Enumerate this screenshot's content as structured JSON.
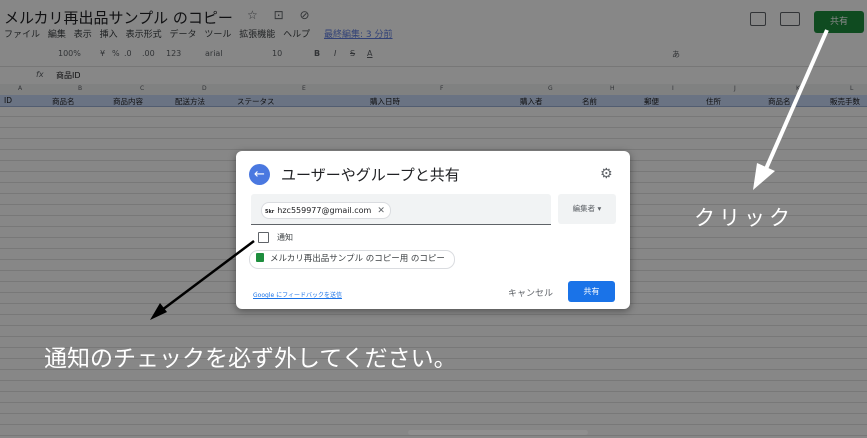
{
  "app": {
    "doc_title": "メルカリ再出品サンプル のコピー",
    "title_icons": "☆ ⊡ ⊘",
    "menu": [
      "ファイル",
      "編集",
      "表示",
      "挿入",
      "表示形式",
      "データ",
      "ツール",
      "拡張機能",
      "ヘルプ"
    ],
    "last_edit": "最終編集: 3 分前",
    "share_button": "共有"
  },
  "toolbar": {
    "zoom": "100%",
    "currency": "¥",
    "percent": "%",
    "decimal_less": ".0",
    "decimal_more": ".00",
    "number_format": "123",
    "font": "arial",
    "font_size": "10",
    "bold": "B",
    "italic": "I",
    "strike": "S",
    "text_color": "A",
    "input_tools": "あ"
  },
  "formula_bar": {
    "cell_ref": "",
    "fx": "fx",
    "content": "商品ID"
  },
  "columns": [
    "A",
    "B",
    "C",
    "D",
    "E",
    "F",
    "G",
    "H",
    "I",
    "J",
    "K",
    "L"
  ],
  "header_row": [
    "ID",
    "商品名",
    "商品内容",
    "配送方法",
    "ステータス",
    "購入日時",
    "購入者",
    "名前",
    "郵便",
    "住所",
    "商品名",
    "販売手数"
  ],
  "dialog": {
    "title": "ユーザーやグループと共有",
    "chip_avatar": "5kr",
    "chip_email": "hzc559977@gmail.com",
    "role": "編集者 ▾",
    "notify_label": "通知",
    "file_name": "メルカリ再出品サンプル のコピー用 のコピー",
    "feedback_link": "Google にフィードバックを送信",
    "cancel": "キャンセル",
    "share": "共有"
  },
  "annotations": {
    "click": "クリック",
    "instruction": "通知のチェックを必ず外してください。"
  },
  "colors": {
    "header_fill": "#c9daf8",
    "share_green": "#1e8e3e",
    "primary_blue": "#1a73e8"
  }
}
